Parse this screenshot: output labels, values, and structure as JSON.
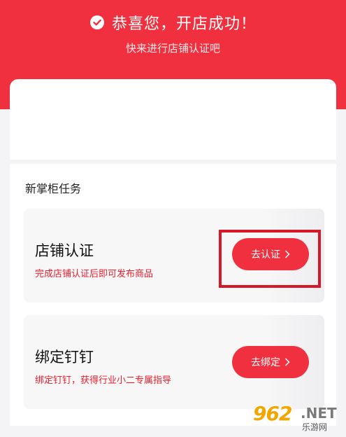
{
  "header": {
    "title": "恭喜您，开店成功！",
    "subtitle": "快来进行店铺认证吧"
  },
  "section": {
    "title": "新掌柜任务"
  },
  "tasks": [
    {
      "name": "店铺认证",
      "description": "完成店铺认证后即可发布商品",
      "button_label": "去认证"
    },
    {
      "name": "绑定钉钉",
      "description": "绑定钉钉，获得行业小二专属指导",
      "button_label": "去绑定"
    }
  ],
  "watermark": {
    "number": "962",
    "suffix": ".NET",
    "text": "乐游网"
  },
  "colors": {
    "brand_red": "#f1303f",
    "desc_red": "#e3202e",
    "highlight": "#d41a29"
  }
}
